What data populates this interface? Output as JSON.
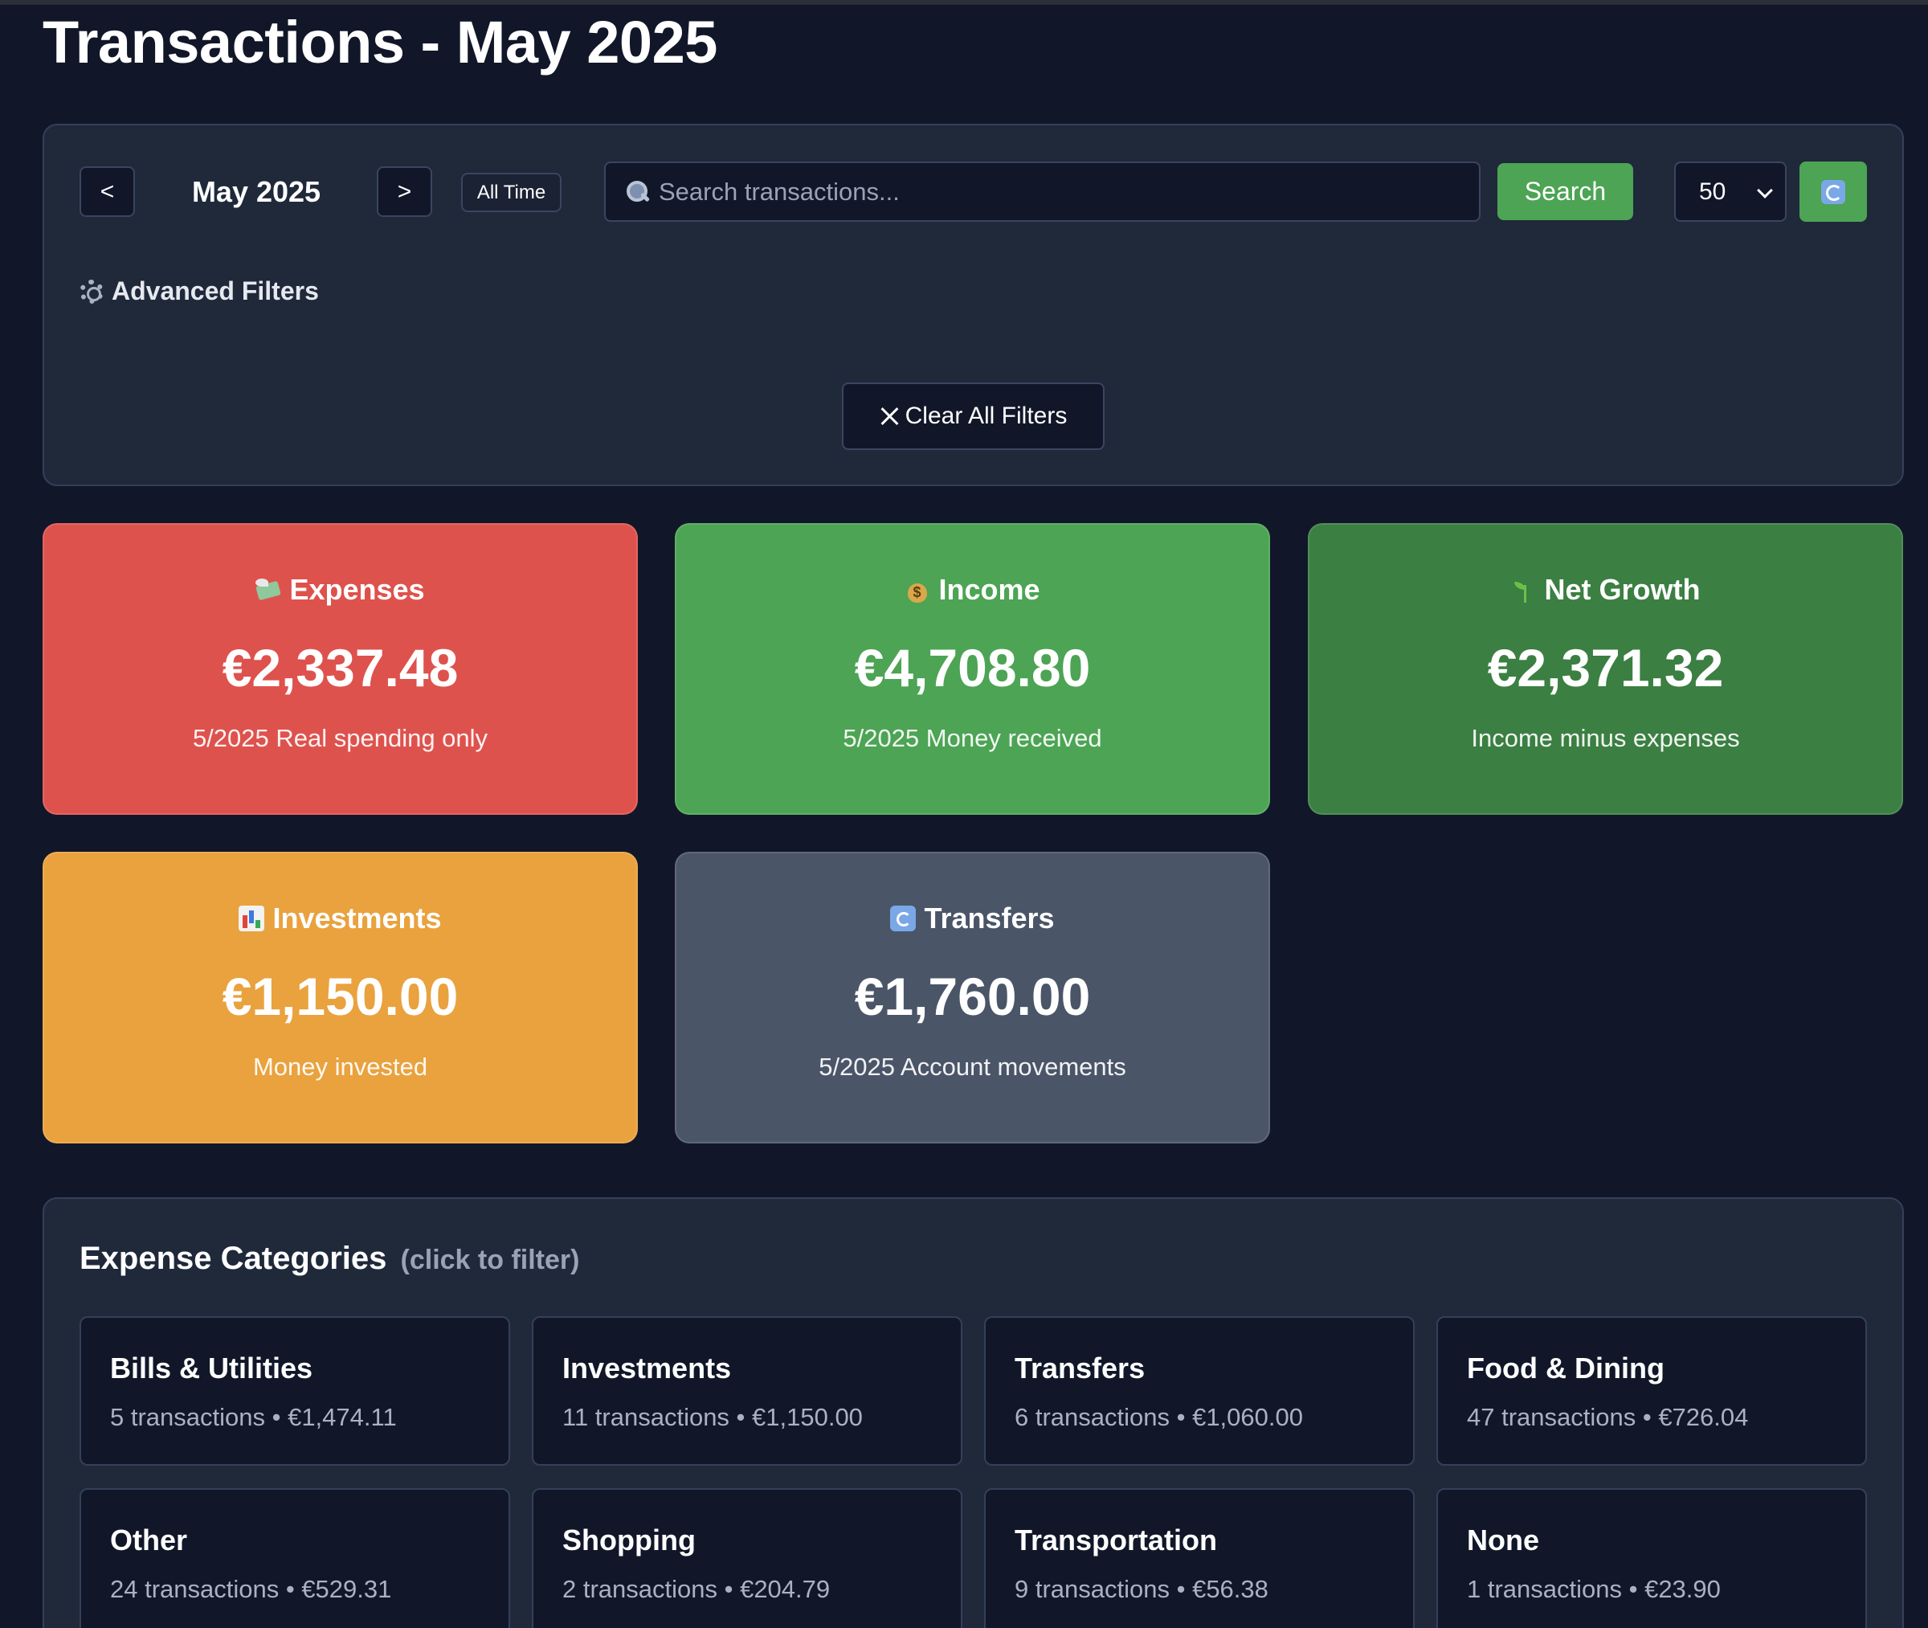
{
  "page": {
    "title": "Transactions - May 2025"
  },
  "filters": {
    "prev_label": "<",
    "next_label": ">",
    "month_label": "May 2025",
    "all_time_label": "All Time",
    "search_placeholder": "Search transactions...",
    "search_value": "",
    "search_button": "Search",
    "page_size": "50",
    "advanced_label": "Advanced Filters",
    "clear_label": "Clear All Filters"
  },
  "summary": [
    {
      "icon": "money-with-wings-icon",
      "title": "Expenses",
      "value": "€2,337.48",
      "subtitle": "5/2025 Real spending only",
      "color": "#de524d"
    },
    {
      "icon": "money-bag-icon",
      "title": "Income",
      "value": "€4,708.80",
      "subtitle": "5/2025 Money received",
      "color": "#4ca454"
    },
    {
      "icon": "seedling-icon",
      "title": "Net Growth",
      "value": "€2,371.32",
      "subtitle": "Income minus expenses",
      "color": "#3b7f42"
    },
    {
      "icon": "bar-chart-icon",
      "title": "Investments",
      "value": "€1,150.00",
      "subtitle": "Money invested",
      "color": "#e9a23e"
    },
    {
      "icon": "transfer-arrows-icon",
      "title": "Transfers",
      "value": "€1,760.00",
      "subtitle": "5/2025 Account movements",
      "color": "#4a5568"
    }
  ],
  "categories": {
    "heading": "Expense Categories",
    "hint": "(click to filter)",
    "items": [
      {
        "name": "Bills & Utilities",
        "meta": "5 transactions • €1,474.11"
      },
      {
        "name": "Investments",
        "meta": "11 transactions • €1,150.00"
      },
      {
        "name": "Transfers",
        "meta": "6 transactions • €1,060.00"
      },
      {
        "name": "Food & Dining",
        "meta": "47 transactions • €726.04"
      },
      {
        "name": "Other",
        "meta": "24 transactions • €529.31"
      },
      {
        "name": "Shopping",
        "meta": "2 transactions • €204.79"
      },
      {
        "name": "Transportation",
        "meta": "9 transactions • €56.38"
      },
      {
        "name": "None",
        "meta": "1 transactions • €23.90"
      }
    ]
  }
}
